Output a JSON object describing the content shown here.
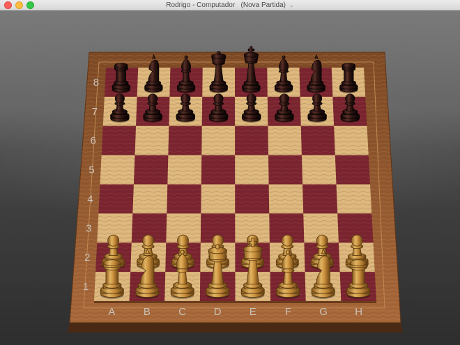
{
  "window": {
    "title": "Rodrigo - Computador   (Nova Partida)",
    "title_menu_icon": "chevron-down-icon",
    "controls": [
      "close",
      "minimize",
      "zoom"
    ]
  },
  "board": {
    "ranks": [
      "8",
      "7",
      "6",
      "5",
      "4",
      "3",
      "2",
      "1"
    ],
    "files": [
      "A",
      "B",
      "C",
      "D",
      "E",
      "F",
      "G",
      "H"
    ],
    "light_square_color": "#dcb67c",
    "dark_square_color": "#7a2430",
    "frame_color": "#9a5a2b",
    "position_fen": "rnbqkbnr/pppppppp/8/8/8/8/PPPPPPPP/RNBQKBNR w",
    "pieces": [
      {
        "square": "a8",
        "type": "rook",
        "color": "black"
      },
      {
        "square": "b8",
        "type": "knight",
        "color": "black"
      },
      {
        "square": "c8",
        "type": "bishop",
        "color": "black"
      },
      {
        "square": "d8",
        "type": "queen",
        "color": "black"
      },
      {
        "square": "e8",
        "type": "king",
        "color": "black"
      },
      {
        "square": "f8",
        "type": "bishop",
        "color": "black"
      },
      {
        "square": "g8",
        "type": "knight",
        "color": "black"
      },
      {
        "square": "h8",
        "type": "rook",
        "color": "black"
      },
      {
        "square": "a7",
        "type": "pawn",
        "color": "black"
      },
      {
        "square": "b7",
        "type": "pawn",
        "color": "black"
      },
      {
        "square": "c7",
        "type": "pawn",
        "color": "black"
      },
      {
        "square": "d7",
        "type": "pawn",
        "color": "black"
      },
      {
        "square": "e7",
        "type": "pawn",
        "color": "black"
      },
      {
        "square": "f7",
        "type": "pawn",
        "color": "black"
      },
      {
        "square": "g7",
        "type": "pawn",
        "color": "black"
      },
      {
        "square": "h7",
        "type": "pawn",
        "color": "black"
      },
      {
        "square": "a2",
        "type": "pawn",
        "color": "white"
      },
      {
        "square": "b2",
        "type": "pawn",
        "color": "white"
      },
      {
        "square": "c2",
        "type": "pawn",
        "color": "white"
      },
      {
        "square": "d2",
        "type": "pawn",
        "color": "white"
      },
      {
        "square": "e2",
        "type": "pawn",
        "color": "white"
      },
      {
        "square": "f2",
        "type": "pawn",
        "color": "white"
      },
      {
        "square": "g2",
        "type": "pawn",
        "color": "white"
      },
      {
        "square": "h2",
        "type": "pawn",
        "color": "white"
      },
      {
        "square": "a1",
        "type": "rook",
        "color": "white"
      },
      {
        "square": "b1",
        "type": "knight",
        "color": "white"
      },
      {
        "square": "c1",
        "type": "bishop",
        "color": "white"
      },
      {
        "square": "d1",
        "type": "queen",
        "color": "white"
      },
      {
        "square": "e1",
        "type": "king",
        "color": "white"
      },
      {
        "square": "f1",
        "type": "bishop",
        "color": "white"
      },
      {
        "square": "g1",
        "type": "knight",
        "color": "white"
      },
      {
        "square": "h1",
        "type": "rook",
        "color": "white"
      }
    ]
  }
}
